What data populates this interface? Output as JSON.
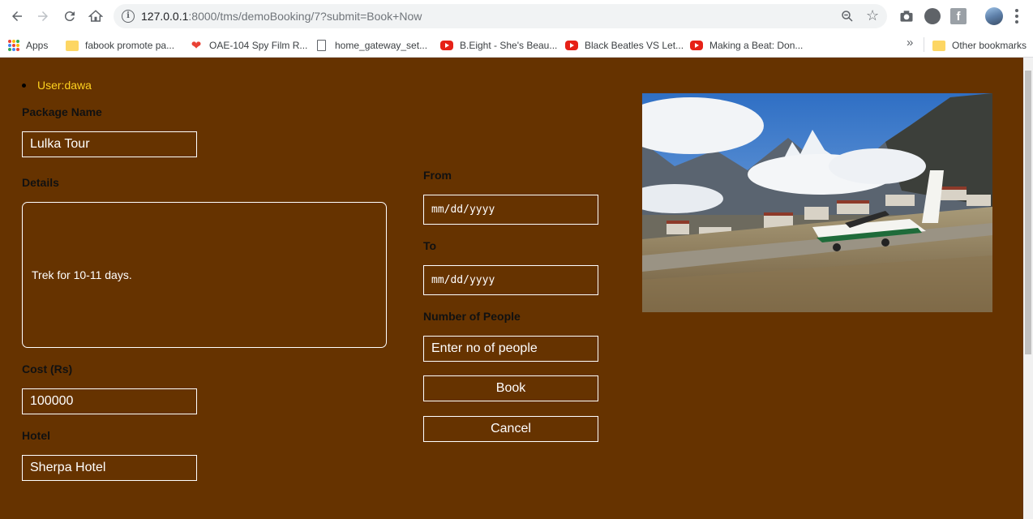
{
  "browser": {
    "url_host": "127.0.0.1",
    "url_rest": ":8000/tms/demoBooking/7?submit=Book+Now",
    "bookmarks": [
      {
        "label": "Apps",
        "icon": "apps-grid-icon"
      },
      {
        "label": "fabook promote pa...",
        "icon": "folder-icon"
      },
      {
        "label": "OAE-104 Spy Film R...",
        "icon": "heart-icon"
      },
      {
        "label": "home_gateway_set...",
        "icon": "document-icon"
      },
      {
        "label": "B.Eight - She's Beau...",
        "icon": "youtube-icon"
      },
      {
        "label": "Black Beatles VS Let...",
        "icon": "youtube-icon"
      },
      {
        "label": "Making a Beat: Don...",
        "icon": "youtube-icon"
      }
    ],
    "overflow_label": "»",
    "other_bookmarks": "Other bookmarks"
  },
  "page": {
    "user": "User:dawa",
    "package_name_label": "Package Name",
    "package_name_value": "Lulka Tour",
    "details_label": "Details",
    "details_value": "Trek for 10-11 days.",
    "cost_label": "Cost (Rs)",
    "cost_value": "100000",
    "hotel_label": "Hotel",
    "hotel_value": "Sherpa Hotel",
    "from_label": "From",
    "from_placeholder": "mm/dd/yyyy",
    "to_label": "To",
    "to_placeholder": "mm/dd/yyyy",
    "people_label": "Number of People",
    "people_placeholder": "Enter no of people",
    "book_label": "Book",
    "cancel_label": "Cancel"
  },
  "colors": {
    "page_background": "#663300",
    "user_text": "#ffd21f",
    "field_border": "#ffffff"
  }
}
